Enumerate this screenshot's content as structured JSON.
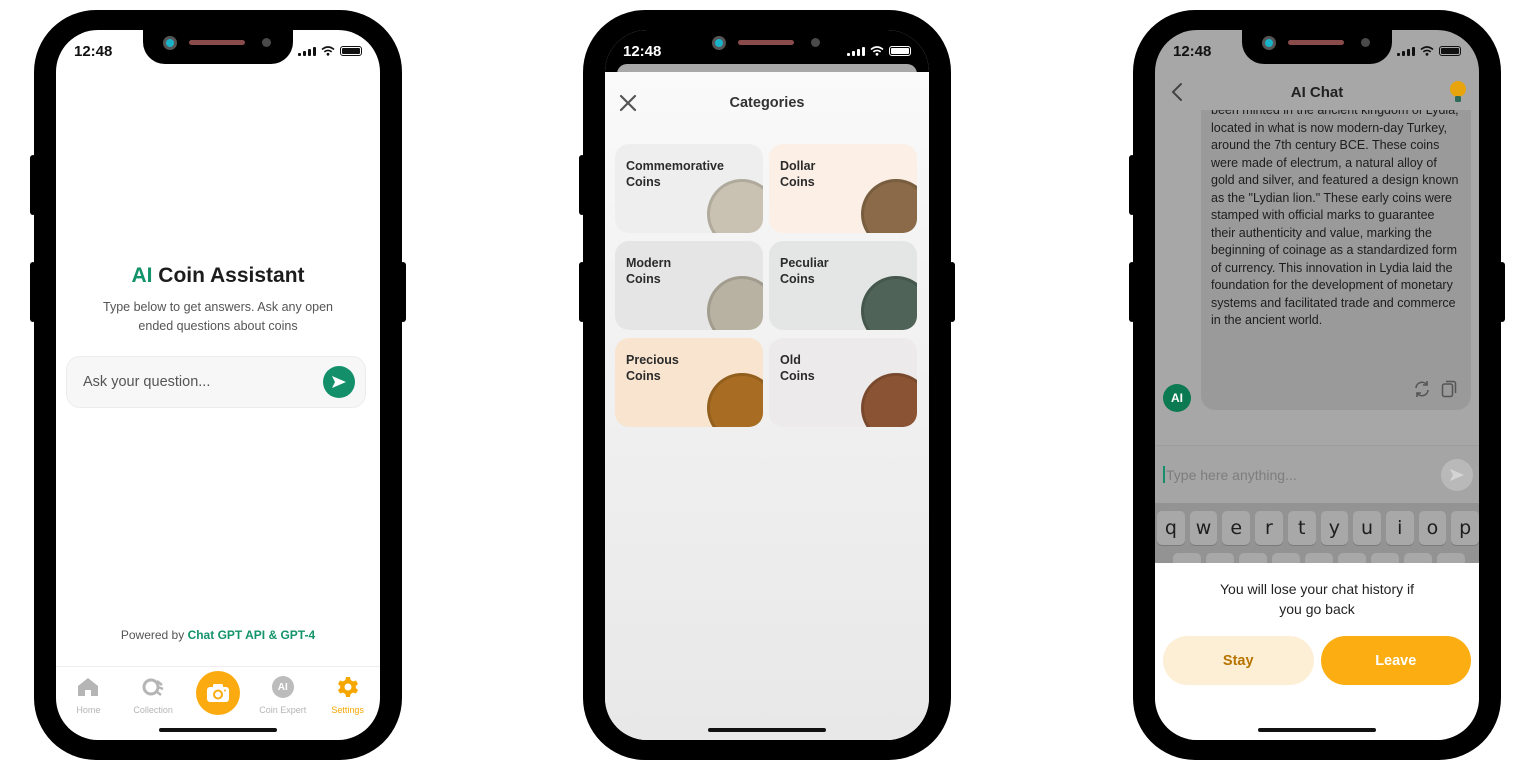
{
  "status_bar": {
    "time": "12:48"
  },
  "phone1": {
    "title_accent": "AI",
    "title_rest": " Coin Assistant",
    "subtitle": "Type below to get answers. Ask any open ended questions about coins",
    "input_placeholder": "Ask your question...",
    "powered_prefix": "Powered by ",
    "powered_brand": "Chat GPT API & GPT-4",
    "tabs": [
      {
        "label": "Home",
        "icon": "home-icon",
        "active": false
      },
      {
        "label": "Collection",
        "icon": "collection-icon",
        "active": false
      },
      {
        "label": "",
        "icon": "camera-icon",
        "active": false
      },
      {
        "label": "Coin Expert",
        "icon": "ai-badge-icon",
        "badge": "AI",
        "active": false
      },
      {
        "label": "Settings",
        "icon": "gear-icon",
        "active": true
      }
    ],
    "colors": {
      "accent_green": "#13936a",
      "accent_orange": "#fbab10"
    }
  },
  "phone2": {
    "title": "Categories",
    "categories": [
      {
        "line1": "Commemorative",
        "line2": "Coins",
        "bg": "#eeeeee",
        "coin_color": "#c9c2b3"
      },
      {
        "line1": "Dollar",
        "line2": "Coins",
        "bg": "#fbefe6",
        "coin_color": "#8a6a48"
      },
      {
        "line1": "Modern",
        "line2": "Coins",
        "bg": "#e4e5e4",
        "coin_color": "#b8b2a2"
      },
      {
        "line1": "Peculiar",
        "line2": "Coins",
        "bg": "#e3e6e5",
        "coin_color": "#4f6358"
      },
      {
        "line1": "Precious",
        "line2": "Coins",
        "bg": "#f8e4cf",
        "coin_color": "#a86d22"
      },
      {
        "line1": "Old",
        "line2": "Coins",
        "bg": "#eceaea",
        "coin_color": "#8a5434"
      }
    ]
  },
  "phone3": {
    "title": "AI Chat",
    "message": "been minted in the ancient kingdom of Lydia, located in what is now modern-day Turkey, around the 7th century BCE. These coins were made of electrum, a natural alloy of gold and silver, and featured a design known as the \"Lydian lion.\" These early coins were stamped with official marks to guarantee their authenticity and value, marking the beginning of coinage as a standardized form of currency. This innovation in Lydia laid the foundation for the development of monetary systems and facilitated trade and commerce in the ancient world.",
    "avatar_label": "AI",
    "input_placeholder": "Type here anything...",
    "keyboard_row1": [
      "q",
      "w",
      "e",
      "r",
      "t",
      "y",
      "u",
      "i",
      "o",
      "p"
    ],
    "dialog_message": "You will lose your chat history if you go back",
    "stay_label": "Stay",
    "leave_label": "Leave"
  }
}
